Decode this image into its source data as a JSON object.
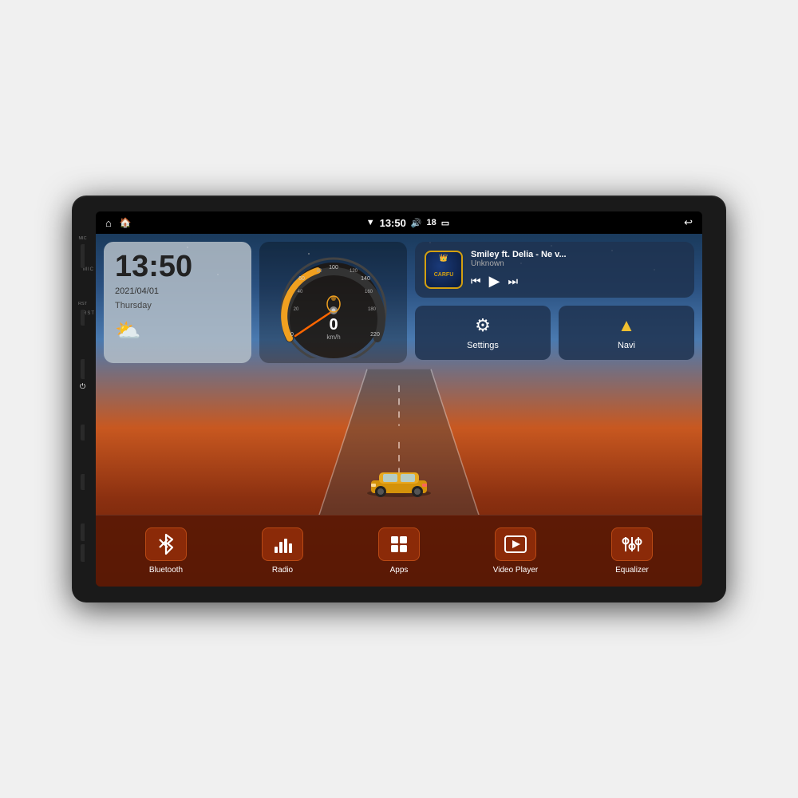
{
  "device": {
    "outer_bg": "#1a1a1a"
  },
  "status_bar": {
    "left_icons": [
      "home",
      "house"
    ],
    "time": "13:50",
    "wifi_icon": "wifi",
    "volume_icon": "volume",
    "volume_level": "18",
    "battery_icon": "battery",
    "back_icon": "back"
  },
  "side_labels": {
    "mic": "MIC",
    "rst": "RST"
  },
  "clock_widget": {
    "time": "13:50",
    "date": "2021/04/01",
    "day": "Thursday",
    "weather": "⛅"
  },
  "speedometer": {
    "speed": "0",
    "unit": "km/h",
    "max": "220"
  },
  "media_player": {
    "title": "Smiley ft. Delia - Ne v...",
    "artist": "Unknown",
    "album_label": "CARFU"
  },
  "quick_buttons": [
    {
      "id": "settings",
      "label": "Settings",
      "icon": "⚙"
    },
    {
      "id": "navi",
      "label": "Navi",
      "icon": "▲"
    }
  ],
  "bottom_apps": [
    {
      "id": "bluetooth",
      "label": "Bluetooth",
      "icon": "bluetooth"
    },
    {
      "id": "radio",
      "label": "Radio",
      "icon": "radio"
    },
    {
      "id": "apps",
      "label": "Apps",
      "icon": "apps"
    },
    {
      "id": "video_player",
      "label": "Video Player",
      "icon": "video"
    },
    {
      "id": "equalizer",
      "label": "Equalizer",
      "icon": "equalizer"
    }
  ]
}
